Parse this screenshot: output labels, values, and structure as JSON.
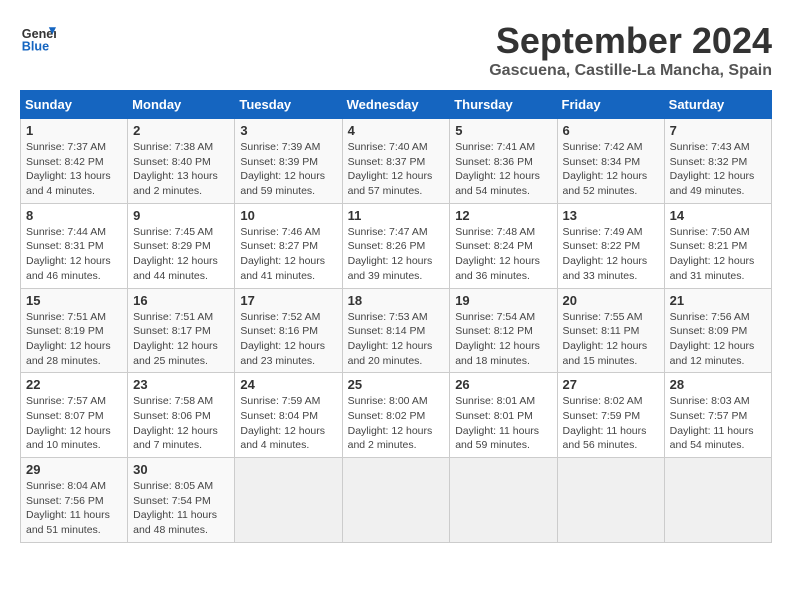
{
  "header": {
    "logo_line1": "General",
    "logo_line2": "Blue",
    "month_year": "September 2024",
    "location": "Gascuena, Castille-La Mancha, Spain"
  },
  "calendar": {
    "days_of_week": [
      "Sunday",
      "Monday",
      "Tuesday",
      "Wednesday",
      "Thursday",
      "Friday",
      "Saturday"
    ],
    "weeks": [
      [
        {
          "day": "",
          "info": ""
        },
        {
          "day": "2",
          "info": "Sunrise: 7:38 AM\nSunset: 8:40 PM\nDaylight: 13 hours and 2 minutes."
        },
        {
          "day": "3",
          "info": "Sunrise: 7:39 AM\nSunset: 8:39 PM\nDaylight: 12 hours and 59 minutes."
        },
        {
          "day": "4",
          "info": "Sunrise: 7:40 AM\nSunset: 8:37 PM\nDaylight: 12 hours and 57 minutes."
        },
        {
          "day": "5",
          "info": "Sunrise: 7:41 AM\nSunset: 8:36 PM\nDaylight: 12 hours and 54 minutes."
        },
        {
          "day": "6",
          "info": "Sunrise: 7:42 AM\nSunset: 8:34 PM\nDaylight: 12 hours and 52 minutes."
        },
        {
          "day": "7",
          "info": "Sunrise: 7:43 AM\nSunset: 8:32 PM\nDaylight: 12 hours and 49 minutes."
        }
      ],
      [
        {
          "day": "1",
          "info": "Sunrise: 7:37 AM\nSunset: 8:42 PM\nDaylight: 13 hours and 4 minutes."
        },
        {
          "day": "",
          "info": ""
        },
        {
          "day": "",
          "info": ""
        },
        {
          "day": "",
          "info": ""
        },
        {
          "day": "",
          "info": ""
        },
        {
          "day": "",
          "info": ""
        },
        {
          "day": "",
          "info": ""
        }
      ],
      [
        {
          "day": "8",
          "info": "Sunrise: 7:44 AM\nSunset: 8:31 PM\nDaylight: 12 hours and 46 minutes."
        },
        {
          "day": "9",
          "info": "Sunrise: 7:45 AM\nSunset: 8:29 PM\nDaylight: 12 hours and 44 minutes."
        },
        {
          "day": "10",
          "info": "Sunrise: 7:46 AM\nSunset: 8:27 PM\nDaylight: 12 hours and 41 minutes."
        },
        {
          "day": "11",
          "info": "Sunrise: 7:47 AM\nSunset: 8:26 PM\nDaylight: 12 hours and 39 minutes."
        },
        {
          "day": "12",
          "info": "Sunrise: 7:48 AM\nSunset: 8:24 PM\nDaylight: 12 hours and 36 minutes."
        },
        {
          "day": "13",
          "info": "Sunrise: 7:49 AM\nSunset: 8:22 PM\nDaylight: 12 hours and 33 minutes."
        },
        {
          "day": "14",
          "info": "Sunrise: 7:50 AM\nSunset: 8:21 PM\nDaylight: 12 hours and 31 minutes."
        }
      ],
      [
        {
          "day": "15",
          "info": "Sunrise: 7:51 AM\nSunset: 8:19 PM\nDaylight: 12 hours and 28 minutes."
        },
        {
          "day": "16",
          "info": "Sunrise: 7:51 AM\nSunset: 8:17 PM\nDaylight: 12 hours and 25 minutes."
        },
        {
          "day": "17",
          "info": "Sunrise: 7:52 AM\nSunset: 8:16 PM\nDaylight: 12 hours and 23 minutes."
        },
        {
          "day": "18",
          "info": "Sunrise: 7:53 AM\nSunset: 8:14 PM\nDaylight: 12 hours and 20 minutes."
        },
        {
          "day": "19",
          "info": "Sunrise: 7:54 AM\nSunset: 8:12 PM\nDaylight: 12 hours and 18 minutes."
        },
        {
          "day": "20",
          "info": "Sunrise: 7:55 AM\nSunset: 8:11 PM\nDaylight: 12 hours and 15 minutes."
        },
        {
          "day": "21",
          "info": "Sunrise: 7:56 AM\nSunset: 8:09 PM\nDaylight: 12 hours and 12 minutes."
        }
      ],
      [
        {
          "day": "22",
          "info": "Sunrise: 7:57 AM\nSunset: 8:07 PM\nDaylight: 12 hours and 10 minutes."
        },
        {
          "day": "23",
          "info": "Sunrise: 7:58 AM\nSunset: 8:06 PM\nDaylight: 12 hours and 7 minutes."
        },
        {
          "day": "24",
          "info": "Sunrise: 7:59 AM\nSunset: 8:04 PM\nDaylight: 12 hours and 4 minutes."
        },
        {
          "day": "25",
          "info": "Sunrise: 8:00 AM\nSunset: 8:02 PM\nDaylight: 12 hours and 2 minutes."
        },
        {
          "day": "26",
          "info": "Sunrise: 8:01 AM\nSunset: 8:01 PM\nDaylight: 11 hours and 59 minutes."
        },
        {
          "day": "27",
          "info": "Sunrise: 8:02 AM\nSunset: 7:59 PM\nDaylight: 11 hours and 56 minutes."
        },
        {
          "day": "28",
          "info": "Sunrise: 8:03 AM\nSunset: 7:57 PM\nDaylight: 11 hours and 54 minutes."
        }
      ],
      [
        {
          "day": "29",
          "info": "Sunrise: 8:04 AM\nSunset: 7:56 PM\nDaylight: 11 hours and 51 minutes."
        },
        {
          "day": "30",
          "info": "Sunrise: 8:05 AM\nSunset: 7:54 PM\nDaylight: 11 hours and 48 minutes."
        },
        {
          "day": "",
          "info": ""
        },
        {
          "day": "",
          "info": ""
        },
        {
          "day": "",
          "info": ""
        },
        {
          "day": "",
          "info": ""
        },
        {
          "day": "",
          "info": ""
        }
      ]
    ]
  }
}
